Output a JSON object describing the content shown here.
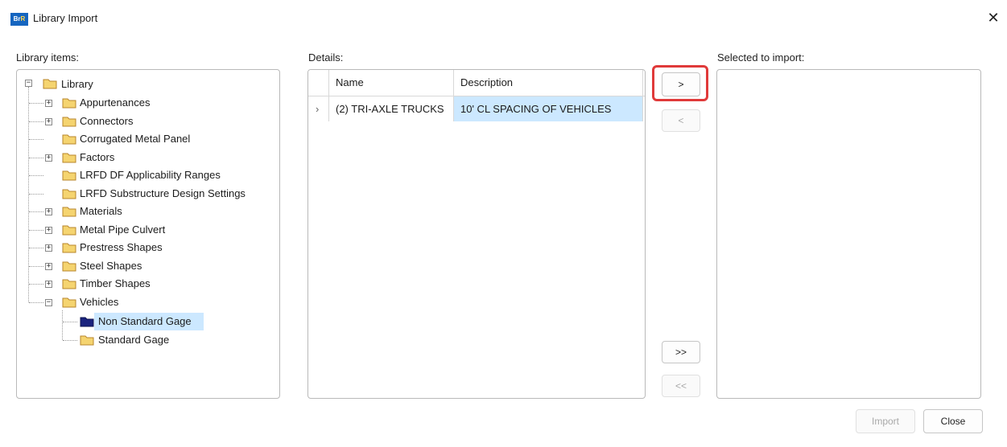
{
  "window": {
    "title": "Library Import",
    "close_glyph": "✕"
  },
  "labels": {
    "library_items": "Library items:",
    "details": "Details:",
    "selected_to_import": "Selected to import:"
  },
  "tree": {
    "root": "Library",
    "items": [
      "Appurtenances",
      "Connectors",
      "Corrugated Metal Panel",
      "Factors",
      "LRFD DF Applicability Ranges",
      "LRFD Substructure Design Settings",
      "Materials",
      "Metal Pipe Culvert",
      "Prestress Shapes",
      "Steel Shapes",
      "Timber Shapes",
      "Vehicles"
    ],
    "vehicles_children": [
      "Non Standard Gage",
      "Standard Gage"
    ]
  },
  "details": {
    "columns": [
      "Name",
      "Description"
    ],
    "rows": [
      {
        "indicator": "›",
        "name": "(2) TRI-AXLE TRUCKS",
        "description": "10' CL SPACING OF VEHICLES"
      }
    ]
  },
  "transfer": {
    "add": ">",
    "remove": "<",
    "add_all": ">>",
    "remove_all": "<<"
  },
  "footer": {
    "import": "Import",
    "close": "Close"
  },
  "colors": {
    "accent_highlight": "#e03a3a",
    "selection": "#cce8ff",
    "folder": "#f2c94c"
  }
}
